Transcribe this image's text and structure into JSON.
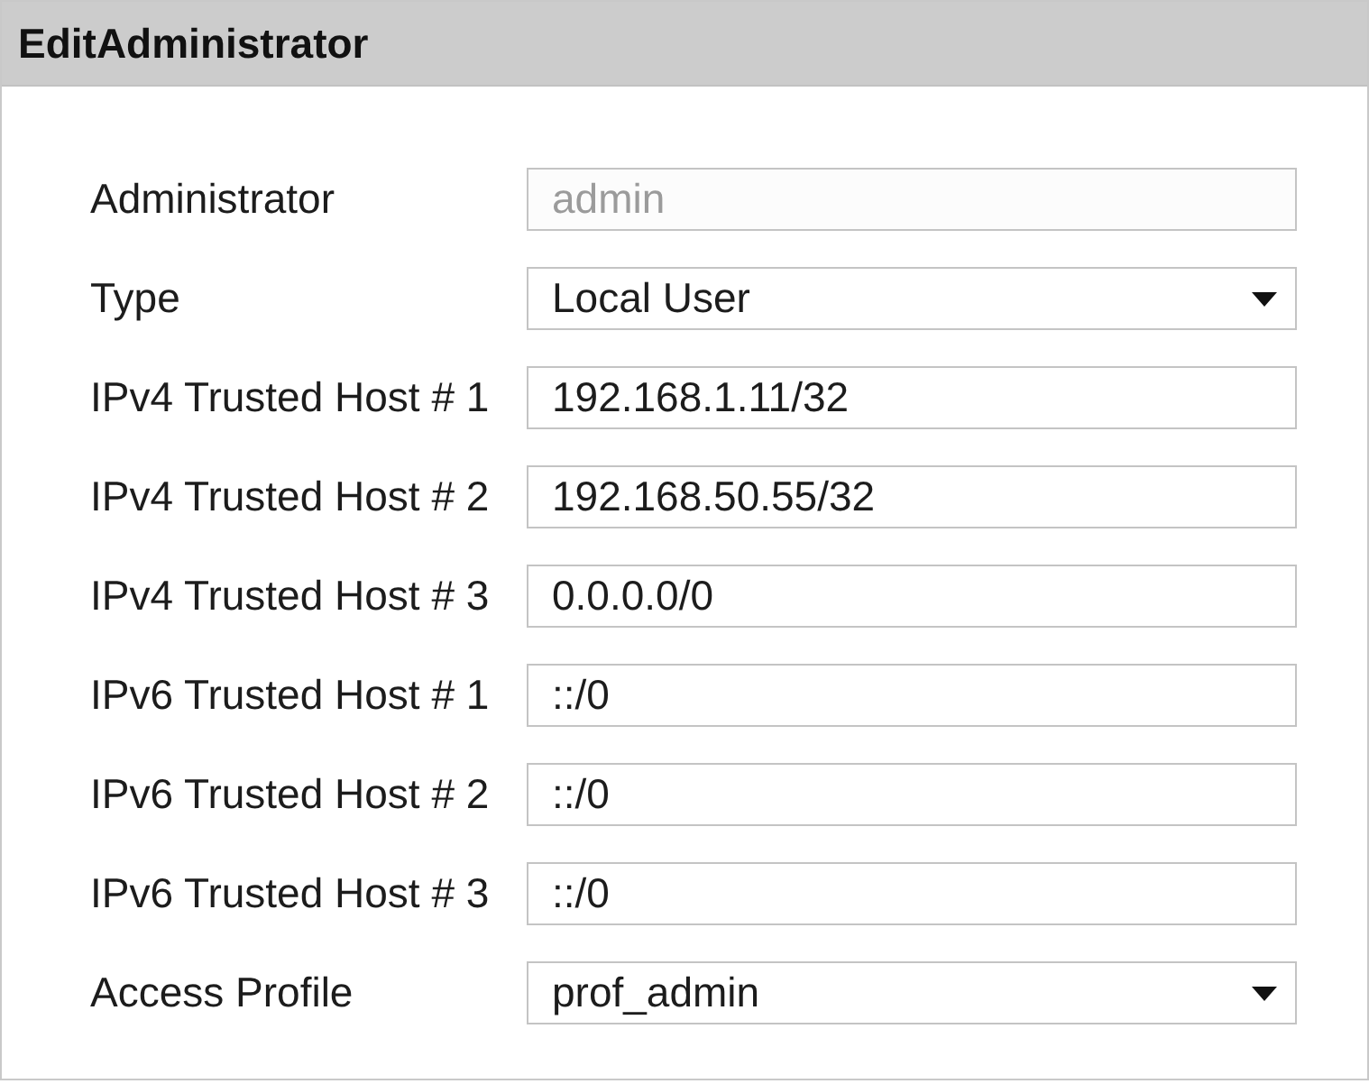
{
  "window": {
    "title": "EditAdministrator"
  },
  "fields": [
    {
      "label": "Administrator",
      "kind": "text",
      "value": "admin",
      "disabled": true
    },
    {
      "label": "Type",
      "kind": "select",
      "value": "Local User",
      "disabled": false
    },
    {
      "label": "IPv4 Trusted Host # 1",
      "kind": "text",
      "value": "192.168.1.11/32",
      "disabled": false
    },
    {
      "label": "IPv4 Trusted Host # 2",
      "kind": "text",
      "value": "192.168.50.55/32",
      "disabled": false
    },
    {
      "label": "IPv4 Trusted Host # 3",
      "kind": "text",
      "value": "0.0.0.0/0",
      "disabled": false
    },
    {
      "label": "IPv6 Trusted Host # 1",
      "kind": "text",
      "value": "::/0",
      "disabled": false
    },
    {
      "label": "IPv6 Trusted Host # 2",
      "kind": "text",
      "value": "::/0",
      "disabled": false
    },
    {
      "label": "IPv6 Trusted Host # 3",
      "kind": "text",
      "value": "::/0",
      "disabled": false
    },
    {
      "label": "Access Profile",
      "kind": "select",
      "value": "prof_admin",
      "disabled": false
    }
  ]
}
